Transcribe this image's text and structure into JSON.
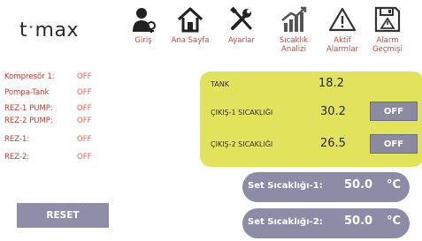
{
  "logo": {
    "left": "t",
    "dot": "•",
    "right": "max"
  },
  "nav": [
    {
      "label_lines": [
        "Giriş"
      ],
      "icon": "user-login-icon"
    },
    {
      "label_lines": [
        "Ana Sayfa"
      ],
      "icon": "home-icon"
    },
    {
      "label_lines": [
        "Ayarlar"
      ],
      "icon": "wrench-screwdriver-icon"
    },
    {
      "label_lines": [
        "Sıcaklık",
        "Analizi"
      ],
      "icon": "chart-growth-icon"
    },
    {
      "label_lines": [
        "Aktif",
        "Alarmlar"
      ],
      "icon": "warning-icon"
    },
    {
      "label_lines": [
        "Alarm",
        "Geçmişi"
      ],
      "icon": "floppy-save-icon"
    }
  ],
  "status": [
    {
      "name": "Kompresör 1:",
      "value": "OFF"
    },
    {
      "name": "Pompa-Tank",
      "value": "OFF"
    },
    {
      "name": "REZ-1 PUMP:",
      "value": "OFF"
    },
    {
      "name": "REZ-2 PUMP:",
      "value": "OFF"
    },
    {
      "name": "REZ-1:",
      "value": "OFF"
    },
    {
      "name": "REZ-2:",
      "value": "OFF"
    }
  ],
  "panel": {
    "tank_label": "TANK",
    "tank_value": "18.2",
    "outlet1_label": "ÇIKIŞ-1 SICAKLIĞI",
    "outlet1_value": "30.2",
    "outlet1_button": "OFF",
    "outlet2_label": "ÇIKIŞ-2 SICAKLIĞI",
    "outlet2_value": "26.5",
    "outlet2_button": "OFF"
  },
  "setpoints": [
    {
      "label": "Set Sıcaklığı-1:",
      "value": "50.0",
      "unit": "°C"
    },
    {
      "label": "Set Sıcaklığı-2:",
      "value": "50.0",
      "unit": "°C"
    }
  ],
  "reset_label": "RESET",
  "colors": {
    "panel_bg": "#e2e25c",
    "button_bg": "#8c8ca6",
    "status_red": "#c0352a",
    "nav_label_red": "#d0453a"
  }
}
